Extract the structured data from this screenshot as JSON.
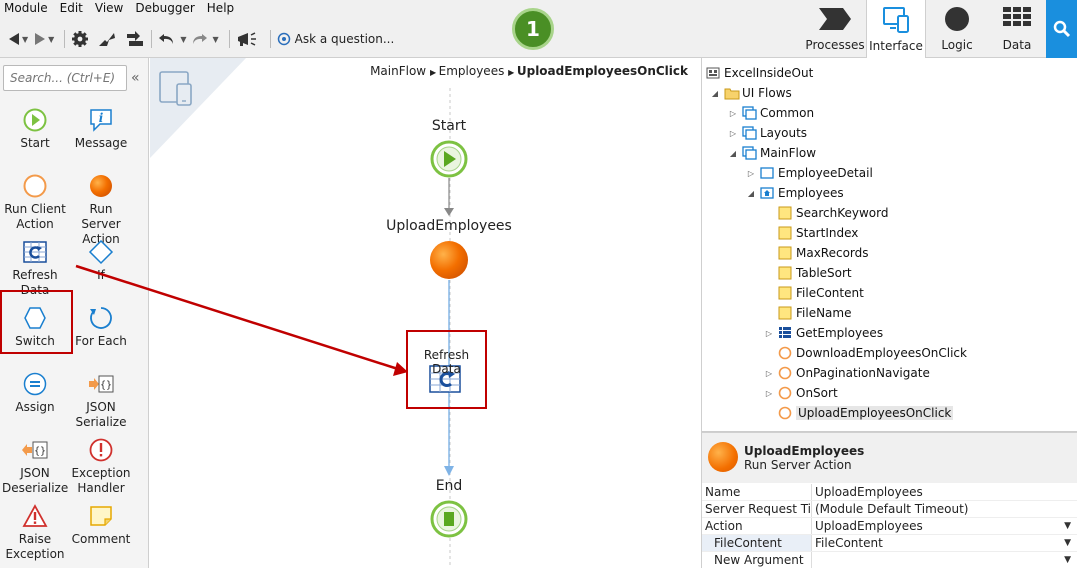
{
  "menu": [
    "Module",
    "Edit",
    "View",
    "Debugger",
    "Help"
  ],
  "toolbar": {
    "ask_label": "Ask a question..."
  },
  "step_badge": "1",
  "nav_tabs": {
    "processes": "Processes",
    "interface": "Interface",
    "logic": "Logic",
    "data": "Data"
  },
  "toolbox": {
    "search_placeholder": "Search... (Ctrl+E)",
    "tools": [
      {
        "label": "Start",
        "icon": "start-icon"
      },
      {
        "label": "Message",
        "icon": "message-icon"
      },
      {
        "label": "Run Client Action",
        "icon": "run-client-action-icon"
      },
      {
        "label": "Run Server Action",
        "icon": "run-server-action-icon"
      },
      {
        "label": "Refresh Data",
        "icon": "refresh-data-icon"
      },
      {
        "label": "If",
        "icon": "if-icon"
      },
      {
        "label": "Switch",
        "icon": "switch-icon"
      },
      {
        "label": "For Each",
        "icon": "for-each-icon"
      },
      {
        "label": "Assign",
        "icon": "assign-icon"
      },
      {
        "label": "JSON Serialize",
        "icon": "json-serialize-icon"
      },
      {
        "label": "JSON Deserialize",
        "icon": "json-deserialize-icon"
      },
      {
        "label": "Exception Handler",
        "icon": "exception-handler-icon"
      },
      {
        "label": "Raise Exception",
        "icon": "raise-exception-icon"
      },
      {
        "label": "Comment",
        "icon": "comment-icon"
      }
    ]
  },
  "canvas": {
    "breadcrumb": {
      "part1": "MainFlow",
      "part2": "Employees",
      "current": "UploadEmployeesOnClick"
    },
    "nodes": {
      "start": "Start",
      "server_action": "UploadEmployees",
      "refresh": "Refresh Data",
      "end": "End"
    }
  },
  "tree": [
    {
      "label": "ExcelInsideOut",
      "icon": "module-icon"
    },
    {
      "label": "UI Flows",
      "icon": "folder-icon"
    },
    {
      "label": "Common",
      "icon": "flow-icon"
    },
    {
      "label": "Layouts",
      "icon": "flow-icon"
    },
    {
      "label": "MainFlow",
      "icon": "flow-icon"
    },
    {
      "label": "EmployeeDetail",
      "icon": "screen-icon"
    },
    {
      "label": "Employees",
      "icon": "screen-home-icon"
    },
    {
      "label": "SearchKeyword",
      "icon": "variable-icon"
    },
    {
      "label": "StartIndex",
      "icon": "variable-icon"
    },
    {
      "label": "MaxRecords",
      "icon": "variable-icon"
    },
    {
      "label": "TableSort",
      "icon": "variable-icon"
    },
    {
      "label": "FileContent",
      "icon": "variable-icon"
    },
    {
      "label": "FileName",
      "icon": "variable-icon"
    },
    {
      "label": "GetEmployees",
      "icon": "aggregate-icon"
    },
    {
      "label": "DownloadEmployeesOnClick",
      "icon": "client-action-icon"
    },
    {
      "label": "OnPaginationNavigate",
      "icon": "client-action-icon"
    },
    {
      "label": "OnSort",
      "icon": "client-action-icon"
    },
    {
      "label": "UploadEmployeesOnClick",
      "icon": "client-action-icon"
    }
  ],
  "props": {
    "title": "UploadEmployees",
    "subtitle": "Run Server Action",
    "rows": [
      {
        "key": "Name",
        "value": "UploadEmployees"
      },
      {
        "key": "Server Request Ti...",
        "value": "(Module Default Timeout)"
      },
      {
        "key": "Action",
        "value": "UploadEmployees"
      },
      {
        "key": "FileContent",
        "value": "FileContent"
      },
      {
        "key": "New Argument",
        "value": ""
      }
    ]
  },
  "colors": {
    "accent_blue": "#1a8fde",
    "highlight_red": "#c00000",
    "start_green": "#7dc242",
    "server_orange": "#f36f00",
    "badge_green": "#4a8f25"
  }
}
